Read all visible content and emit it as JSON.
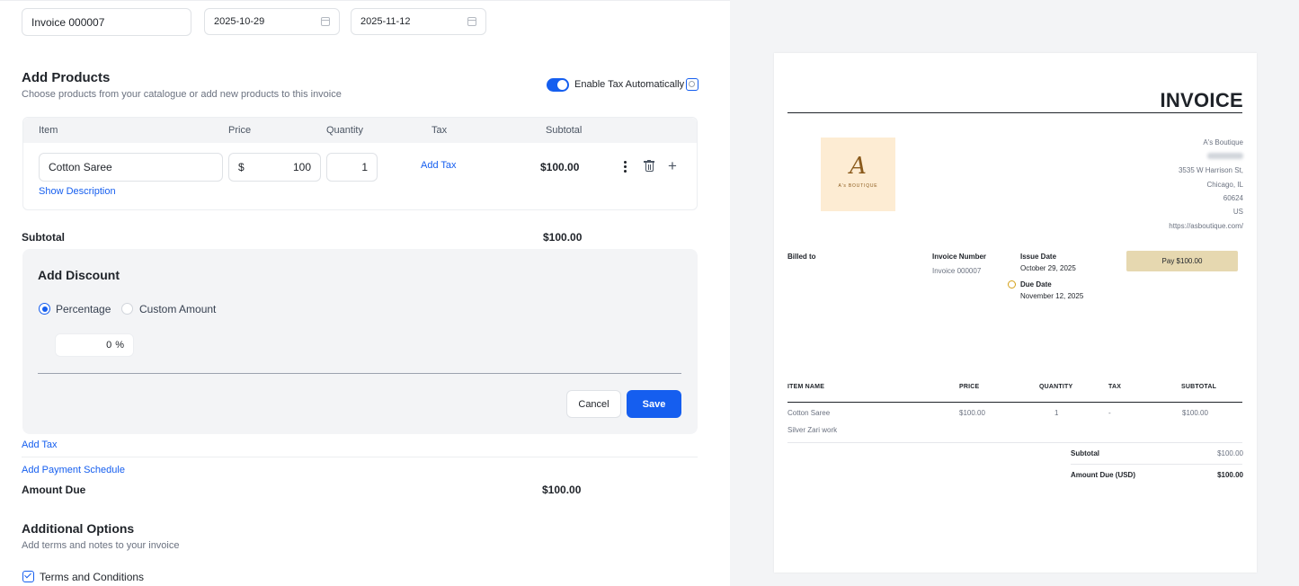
{
  "header": {
    "invoice_title": "Invoice 000007",
    "issue_date": "2025-10-29",
    "due_date": "2025-11-12"
  },
  "products": {
    "title": "Add Products",
    "subtitle": "Choose products from your catalogue or add new products to this invoice",
    "tax_toggle_label": "Enable Tax Automatically",
    "columns": [
      "Item",
      "Price",
      "Quantity",
      "Tax",
      "Subtotal"
    ],
    "row": {
      "item": "Cotton Saree",
      "currency": "$",
      "price": "100",
      "quantity": "1",
      "add_tax": "Add Tax",
      "subtotal": "$100.00",
      "show_description": "Show Description"
    }
  },
  "summary": {
    "subtotal_label": "Subtotal",
    "subtotal_value": "$100.00",
    "add_tax": "Add Tax",
    "add_payment_schedule": "Add Payment Schedule",
    "amount_due_label": "Amount Due",
    "amount_due_value": "$100.00"
  },
  "discount": {
    "title": "Add Discount",
    "option_percentage": "Percentage",
    "option_custom": "Custom Amount",
    "value": "0",
    "unit": "%",
    "cancel": "Cancel",
    "save": "Save"
  },
  "additional": {
    "title": "Additional Options",
    "subtitle": "Add terms and notes to your invoice",
    "terms_label": "Terms and Conditions"
  },
  "preview": {
    "heading": "INVOICE",
    "logo_letter": "A",
    "logo_text": "A's BOUTIQUE",
    "company": "A's Boutique",
    "address_line1": "3535 W Harrison St,",
    "address_line2": "Chicago, IL",
    "address_line3": "60624",
    "address_line4": "US",
    "website": "https://asboutique.com/",
    "billed_to": "Billed to",
    "invoice_number_label": "Invoice Number",
    "invoice_number": "Invoice 000007",
    "issue_date_label": "Issue Date",
    "issue_date": "October 29, 2025",
    "due_date_label": "Due Date",
    "due_date": "November 12, 2025",
    "pay_button": "Pay $100.00",
    "columns": [
      "ITEM NAME",
      "PRICE",
      "QUANTITY",
      "TAX",
      "SUBTOTAL"
    ],
    "item": {
      "name": "Cotton Saree",
      "description": "Silver Zari work",
      "price": "$100.00",
      "quantity": "1",
      "tax": "-",
      "subtotal": "$100.00"
    },
    "subtotal_label": "Subtotal",
    "subtotal_value": "$100.00",
    "amount_due_label": "Amount Due (USD)",
    "amount_due_value": "$100.00"
  },
  "colors": {
    "accent": "#155eef",
    "pay_button": "#e6d8b0",
    "logo_bg": "#fdecd3",
    "logo_ink": "#8a5a1c"
  }
}
